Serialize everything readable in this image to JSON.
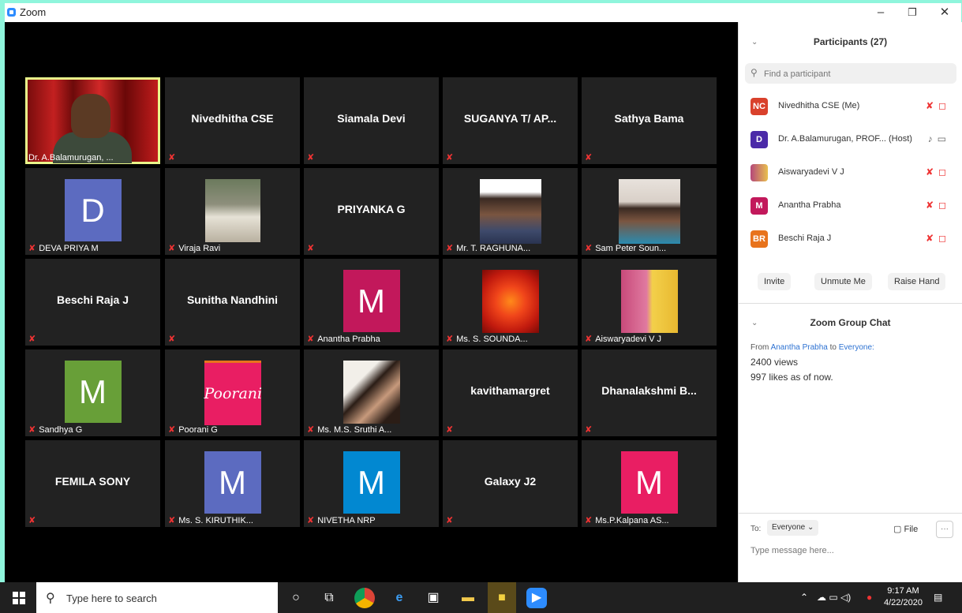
{
  "window": {
    "title": "Zoom",
    "minimize": "–",
    "restore": "❐",
    "close": "✕"
  },
  "tiles": [
    {
      "label": "Dr. A.Balamurugan, ..."
    },
    {
      "name": "Nivedhitha CSE"
    },
    {
      "name": "Siamala Devi"
    },
    {
      "name": "SUGANYA T/ AP..."
    },
    {
      "name": "Sathya Bama"
    },
    {
      "label": "DEVA PRIYA M",
      "initial": "D"
    },
    {
      "label": "Viraja Ravi"
    },
    {
      "name": "PRIYANKA G"
    },
    {
      "label": "Mr. T. RAGHUNA..."
    },
    {
      "label": "Sam Peter Soun..."
    },
    {
      "name": "Beschi Raja J"
    },
    {
      "name": "Sunitha Nandhini"
    },
    {
      "label": "Anantha Prabha",
      "initial": "M"
    },
    {
      "label": "Ms. S. SOUNDA..."
    },
    {
      "label": "Aiswaryadevi V J"
    },
    {
      "label": "Sandhya G",
      "initial": "M"
    },
    {
      "label": "Poorani G",
      "logo_text": "Poorani"
    },
    {
      "label": "Ms. M.S. Sruthi A..."
    },
    {
      "name": "kavithamargret"
    },
    {
      "name": "Dhanalakshmi B..."
    },
    {
      "name": "FEMILA SONY"
    },
    {
      "label": "Ms. S. KIRUTHIK...",
      "initial": "M"
    },
    {
      "label": "NIVETHA NRP",
      "initial": "M"
    },
    {
      "name": "Galaxy J2"
    },
    {
      "label": "Ms.P.Kalpana AS...",
      "initial": "M"
    }
  ],
  "participants": {
    "title": "Participants (27)",
    "search_placeholder": "Find a participant",
    "list": [
      {
        "initials": "NC",
        "name": "Nivedhitha CSE (Me)",
        "color": "#d9412c"
      },
      {
        "initials": "D",
        "name": "Dr. A.Balamurugan, PROF... (Host)",
        "color": "#4b2aa8"
      },
      {
        "initials": "",
        "name": "Aiswaryadevi V J",
        "color": "#c9a27a"
      },
      {
        "initials": "M",
        "name": "Anantha Prabha",
        "color": "#c2185b"
      },
      {
        "initials": "BR",
        "name": "Beschi Raja J",
        "color": "#e8731c"
      }
    ],
    "buttons": {
      "invite": "Invite",
      "unmute": "Unmute Me",
      "raise_hand": "Raise Hand"
    }
  },
  "chat": {
    "title": "Zoom Group Chat",
    "from_prefix": "From",
    "from_name": "Anantha Prabha",
    "to_word": "to",
    "to_name": "Everyone:",
    "messages": [
      "2400 views",
      "997 likes as of now."
    ],
    "to_label": "To:",
    "to_value": "Everyone",
    "file_label": "File",
    "more": "···",
    "input_placeholder": "Type message here..."
  },
  "taskbar": {
    "search_placeholder": "Type here to search",
    "time": "9:17 AM",
    "date": "4/22/2020"
  },
  "colors": {
    "accent_blue": "#2d8cff",
    "mute_red": "#e33333",
    "active_speaker": "#e9f58a",
    "avatar_blue": "#5c6bc0",
    "avatar_magenta": "#c2185b",
    "avatar_green": "#689f38",
    "avatar_cyan": "#0288d1",
    "avatar_pink": "#e91e63"
  }
}
